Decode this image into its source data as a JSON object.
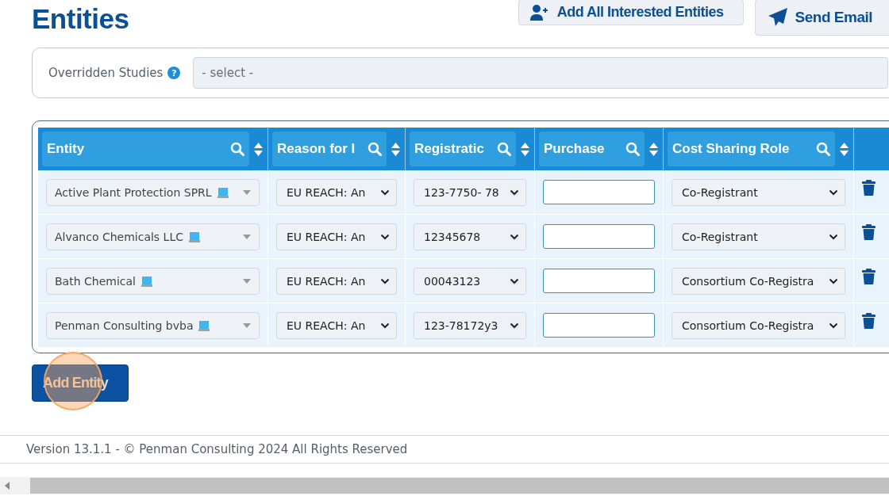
{
  "title": "Entities",
  "actions": [
    {
      "kind": "add-people",
      "label": "Add All Interested Entities"
    },
    {
      "kind": "send",
      "label": "Send Email"
    }
  ],
  "filter": {
    "label": "Overridden Studies",
    "help": "?",
    "placeholder": "- select -"
  },
  "table": {
    "columns": [
      "Entity",
      "Reason for I",
      "Registratic",
      "Purchase",
      "Cost Sharing Role"
    ],
    "rows": [
      {
        "entity": "Active Plant Protection SPRL",
        "reason": "EU REACH: An",
        "registration": "123-7750- 78",
        "role": "Co-Registrant"
      },
      {
        "entity": "Alvanco Chemicals LLC",
        "reason": "EU REACH: An",
        "registration": "12345678",
        "role": "Co-Registrant"
      },
      {
        "entity": "Bath Chemical",
        "reason": "EU REACH: An",
        "registration": "00043123",
        "role": "Consortium Co-Registra"
      },
      {
        "entity": "Penman Consulting bvba",
        "reason": "EU REACH: An",
        "registration": "123-78172y3",
        "role": "Consortium Co-Registra"
      }
    ]
  },
  "add_button": "Add Entity",
  "footer": "Version 13.1.1 - © Penman Consulting 2024 All Rights Reserved"
}
